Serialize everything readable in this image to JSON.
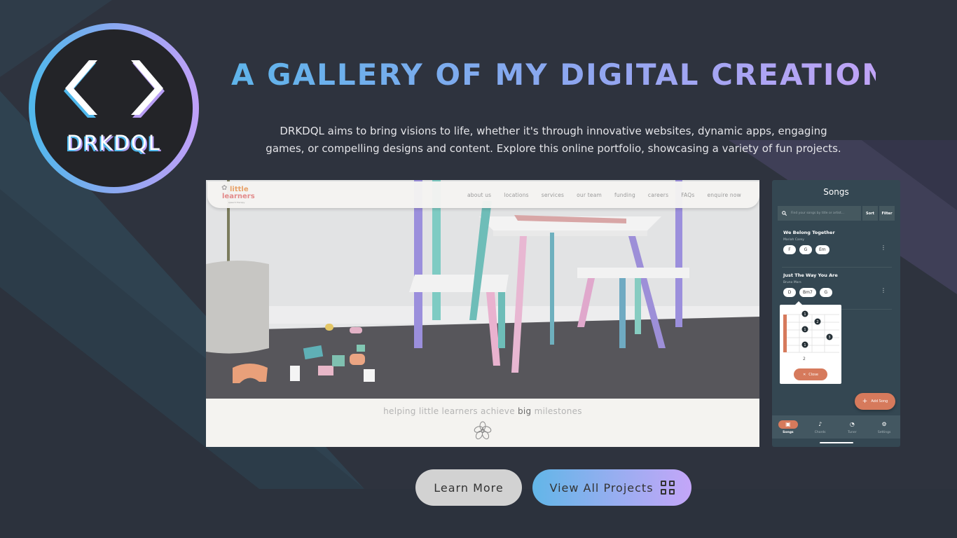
{
  "brand": {
    "name": "DRKDQL",
    "logo_icon": "code-brackets-icon",
    "gradient_start": "#4fb8ec",
    "gradient_end": "#c0a0f8"
  },
  "hero": {
    "title": "A GALLERY OF MY DIGITAL CREATIONS",
    "description_line1": "DRKDQL aims to bring visions to life, whether it's through innovative websites, dynamic apps, engaging",
    "description_line2": "games, or compelling designs and content. Explore this online portfolio, showcasing a variety of fun projects."
  },
  "website_preview": {
    "logo_line1": "little",
    "logo_line2": "learners",
    "logo_line3": "speech therapy",
    "nav_links": [
      "about us",
      "locations",
      "services",
      "our team",
      "funding",
      "careers",
      "FAQs",
      "enquire now"
    ],
    "tagline_before": "helping little learners achieve ",
    "tagline_bold": "big",
    "tagline_after": " milestones",
    "photo_alt": "children's pastel table and chairs with wooden blocks"
  },
  "app_preview": {
    "title": "Songs",
    "search_placeholder": "Find your songs by title or artist...",
    "sort_label": "Sort",
    "filter_label": "Filter",
    "songs": [
      {
        "title": "We Belong Together",
        "artist": "Mariah Carey",
        "chords": [
          "F",
          "G",
          "Em"
        ]
      },
      {
        "title": "Just The Way You Are",
        "artist": "Bruno Mars",
        "chords": [
          "D",
          "Bm7",
          "G"
        ]
      }
    ],
    "chord_popup": {
      "chord": "Bm7",
      "fret_label": "2",
      "fingers": [
        "1",
        "2",
        "1",
        "3",
        "1"
      ],
      "close_label": "Close"
    },
    "add_song_label": "Add Song",
    "tabs": [
      {
        "label": "Songs",
        "icon": "songs-icon",
        "active": true
      },
      {
        "label": "Chords",
        "icon": "guitar-icon",
        "active": false
      },
      {
        "label": "Tuner",
        "icon": "gauge-icon",
        "active": false
      },
      {
        "label": "Settings",
        "icon": "gear-icon",
        "active": false
      }
    ],
    "accent": "#d67a5c",
    "background": "#344752"
  },
  "actions": {
    "learn_more": "Learn More",
    "view_all": "View All Projects",
    "view_all_icon": "grid-icon"
  }
}
